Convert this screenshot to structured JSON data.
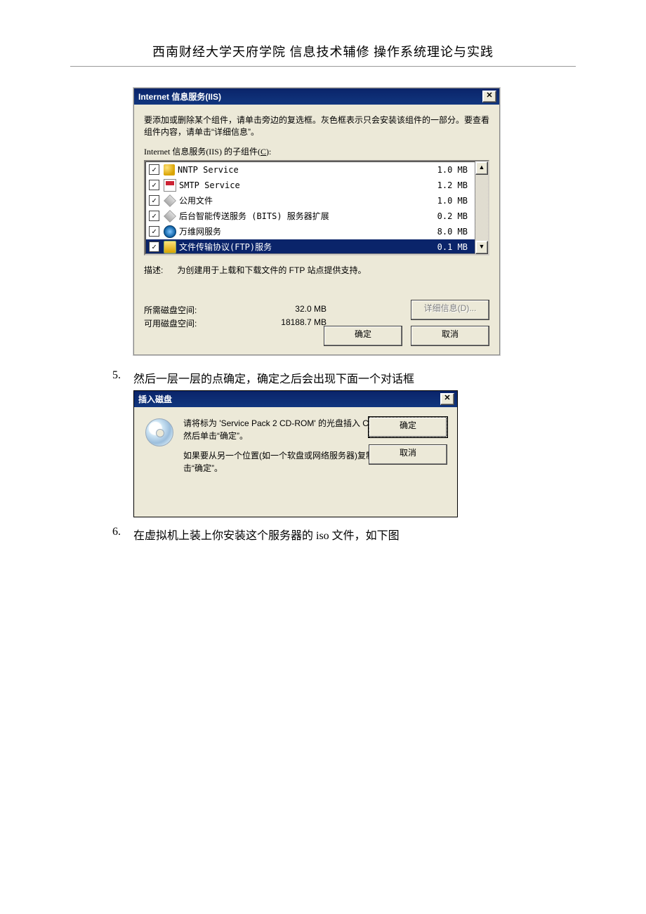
{
  "document": {
    "header": "西南财经大学天府学院 信息技术辅修 操作系统理论与实践",
    "step5_num": "5.",
    "step5_text": "然后一层一层的点确定，确定之后会出现下面一个对话框",
    "step6_num": "6.",
    "step6_text": "在虚拟机上装上你安装这个服务器的 iso 文件，如下图"
  },
  "iis_dialog": {
    "title": "Internet 信息服务(IIS)",
    "instruction": "要添加或删除某个组件，请单击旁边的复选框。灰色框表示只会安装该组件的一部分。要查看组件内容，请单击“详细信息”。",
    "subcomp_label_prefix": "Internet 信息服务(IIS) 的子组件(",
    "subcomp_label_key": "C",
    "subcomp_label_suffix": "):",
    "items": [
      {
        "checked": true,
        "icon": "stack",
        "label": "NNTP Service",
        "size": "1.0 MB"
      },
      {
        "checked": true,
        "icon": "smtp",
        "label": "SMTP Service",
        "size": "1.2 MB"
      },
      {
        "checked": true,
        "icon": "diamond",
        "label": "公用文件",
        "size": "1.0 MB"
      },
      {
        "checked": true,
        "icon": "diamond",
        "label": "后台智能传送服务 (BITS) 服务器扩展",
        "size": "0.2 MB"
      },
      {
        "checked": true,
        "icon": "world",
        "label": "万维网服务",
        "size": "8.0 MB"
      },
      {
        "checked": true,
        "icon": "folder",
        "label": "文件传输协议(FTP)服务",
        "size": "0.1 MB",
        "selected": true
      }
    ],
    "desc_label": "描述:",
    "desc_text": "为创建用于上载和下载文件的 FTP 站点提供支持。",
    "disk_need_label": "所需磁盘空间:",
    "disk_need_value": "32.0 MB",
    "disk_avail_label": "可用磁盘空间:",
    "disk_avail_value": "18188.7 MB",
    "btn_details": "详细信息(D)...",
    "btn_ok": "确定",
    "btn_cancel": "取消"
  },
  "insert_dialog": {
    "title": "插入磁盘",
    "msg1": "请将标为 'Service Pack 2 CD-ROM' 的光盘插入 CD-ROM 驱动器(D:)，然后单击“确定”。",
    "msg2": "如果要从另一个位置(如一个软盘或网络服务器)复制文件，也可以单击“确定”。",
    "btn_ok": "确定",
    "btn_cancel": "取消"
  }
}
